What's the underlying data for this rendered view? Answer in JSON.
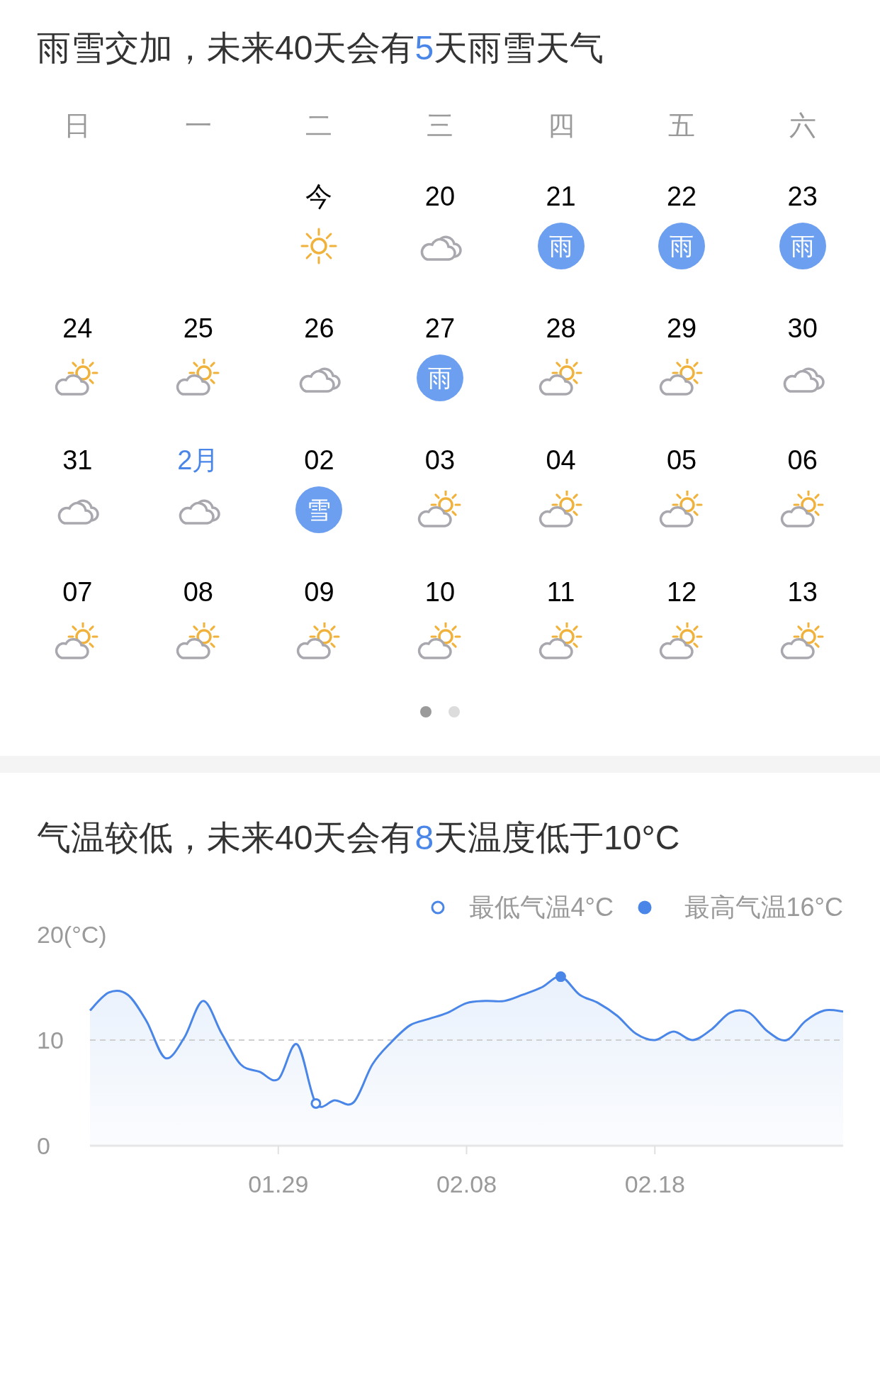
{
  "calendar": {
    "headline": {
      "before": "雨雪交加，未来40天会有",
      "count": "5",
      "after": "天雨雪天气"
    },
    "weekdays": [
      "日",
      "一",
      "二",
      "三",
      "四",
      "五",
      "六"
    ],
    "weeks": [
      [
        {
          "kind": "empty"
        },
        {
          "kind": "empty"
        },
        {
          "label": "今",
          "accent": false,
          "kind": "sunny"
        },
        {
          "label": "20",
          "accent": false,
          "kind": "cloudy"
        },
        {
          "label": "21",
          "accent": false,
          "kind": "rain",
          "badge": "雨"
        },
        {
          "label": "22",
          "accent": false,
          "kind": "rain",
          "badge": "雨"
        },
        {
          "label": "23",
          "accent": false,
          "kind": "rain",
          "badge": "雨"
        }
      ],
      [
        {
          "label": "24",
          "accent": false,
          "kind": "partly_cloudy"
        },
        {
          "label": "25",
          "accent": false,
          "kind": "partly_cloudy"
        },
        {
          "label": "26",
          "accent": false,
          "kind": "cloudy"
        },
        {
          "label": "27",
          "accent": false,
          "kind": "rain",
          "badge": "雨"
        },
        {
          "label": "28",
          "accent": false,
          "kind": "partly_cloudy"
        },
        {
          "label": "29",
          "accent": false,
          "kind": "partly_cloudy"
        },
        {
          "label": "30",
          "accent": false,
          "kind": "cloudy"
        }
      ],
      [
        {
          "label": "31",
          "accent": false,
          "kind": "cloudy"
        },
        {
          "label": "2月",
          "accent": true,
          "kind": "cloudy"
        },
        {
          "label": "02",
          "accent": false,
          "kind": "snow",
          "badge": "雪"
        },
        {
          "label": "03",
          "accent": false,
          "kind": "partly_cloudy"
        },
        {
          "label": "04",
          "accent": false,
          "kind": "partly_cloudy"
        },
        {
          "label": "05",
          "accent": false,
          "kind": "partly_cloudy"
        },
        {
          "label": "06",
          "accent": false,
          "kind": "partly_cloudy"
        }
      ],
      [
        {
          "label": "07",
          "accent": false,
          "kind": "partly_cloudy"
        },
        {
          "label": "08",
          "accent": false,
          "kind": "partly_cloudy"
        },
        {
          "label": "09",
          "accent": false,
          "kind": "partly_cloudy"
        },
        {
          "label": "10",
          "accent": false,
          "kind": "partly_cloudy"
        },
        {
          "label": "11",
          "accent": false,
          "kind": "partly_cloudy"
        },
        {
          "label": "12",
          "accent": false,
          "kind": "partly_cloudy"
        },
        {
          "label": "13",
          "accent": false,
          "kind": "partly_cloudy"
        }
      ]
    ],
    "pages": [
      {
        "selected": true
      },
      {
        "selected": false
      }
    ]
  },
  "temperature": {
    "headline": {
      "before": "气温较低，未来40天会有",
      "count": "8",
      "after": "天温度低于10°C"
    },
    "legend": [
      {
        "kind": "low",
        "label": "最低气温4°C"
      },
      {
        "kind": "high",
        "label": "最高气温16°C"
      }
    ],
    "chart_data": {
      "type": "area",
      "series": [
        {
          "color": "#4a86e8",
          "values": [
            12.8,
            14.5,
            14.3,
            11.8,
            8.3,
            10.2,
            13.7,
            10.6,
            7.7,
            7.0,
            6.3,
            9.6,
            4.0,
            4.3,
            4.1,
            7.7,
            9.8,
            11.4,
            12.0,
            12.6,
            13.5,
            13.7,
            13.7,
            14.3,
            15.0,
            16.0,
            14.3,
            13.5,
            12.3,
            10.6,
            10.0,
            10.8,
            10.0,
            11.0,
            12.6,
            12.6,
            10.8,
            10.0,
            11.8,
            12.8,
            12.7
          ]
        }
      ],
      "categories": [
        null,
        null,
        null,
        null,
        null,
        null,
        null,
        null,
        null,
        null,
        "01.29",
        null,
        null,
        null,
        null,
        null,
        null,
        null,
        null,
        null,
        "02.08",
        null,
        null,
        null,
        null,
        null,
        null,
        null,
        null,
        null,
        "02.18",
        null,
        null,
        null,
        null,
        null,
        null,
        null,
        null,
        null,
        null
      ],
      "ylim": [
        0,
        20
      ],
      "yticks": [
        0,
        10,
        {
          "value": 20,
          "label": "20(°C)"
        }
      ]
    }
  }
}
